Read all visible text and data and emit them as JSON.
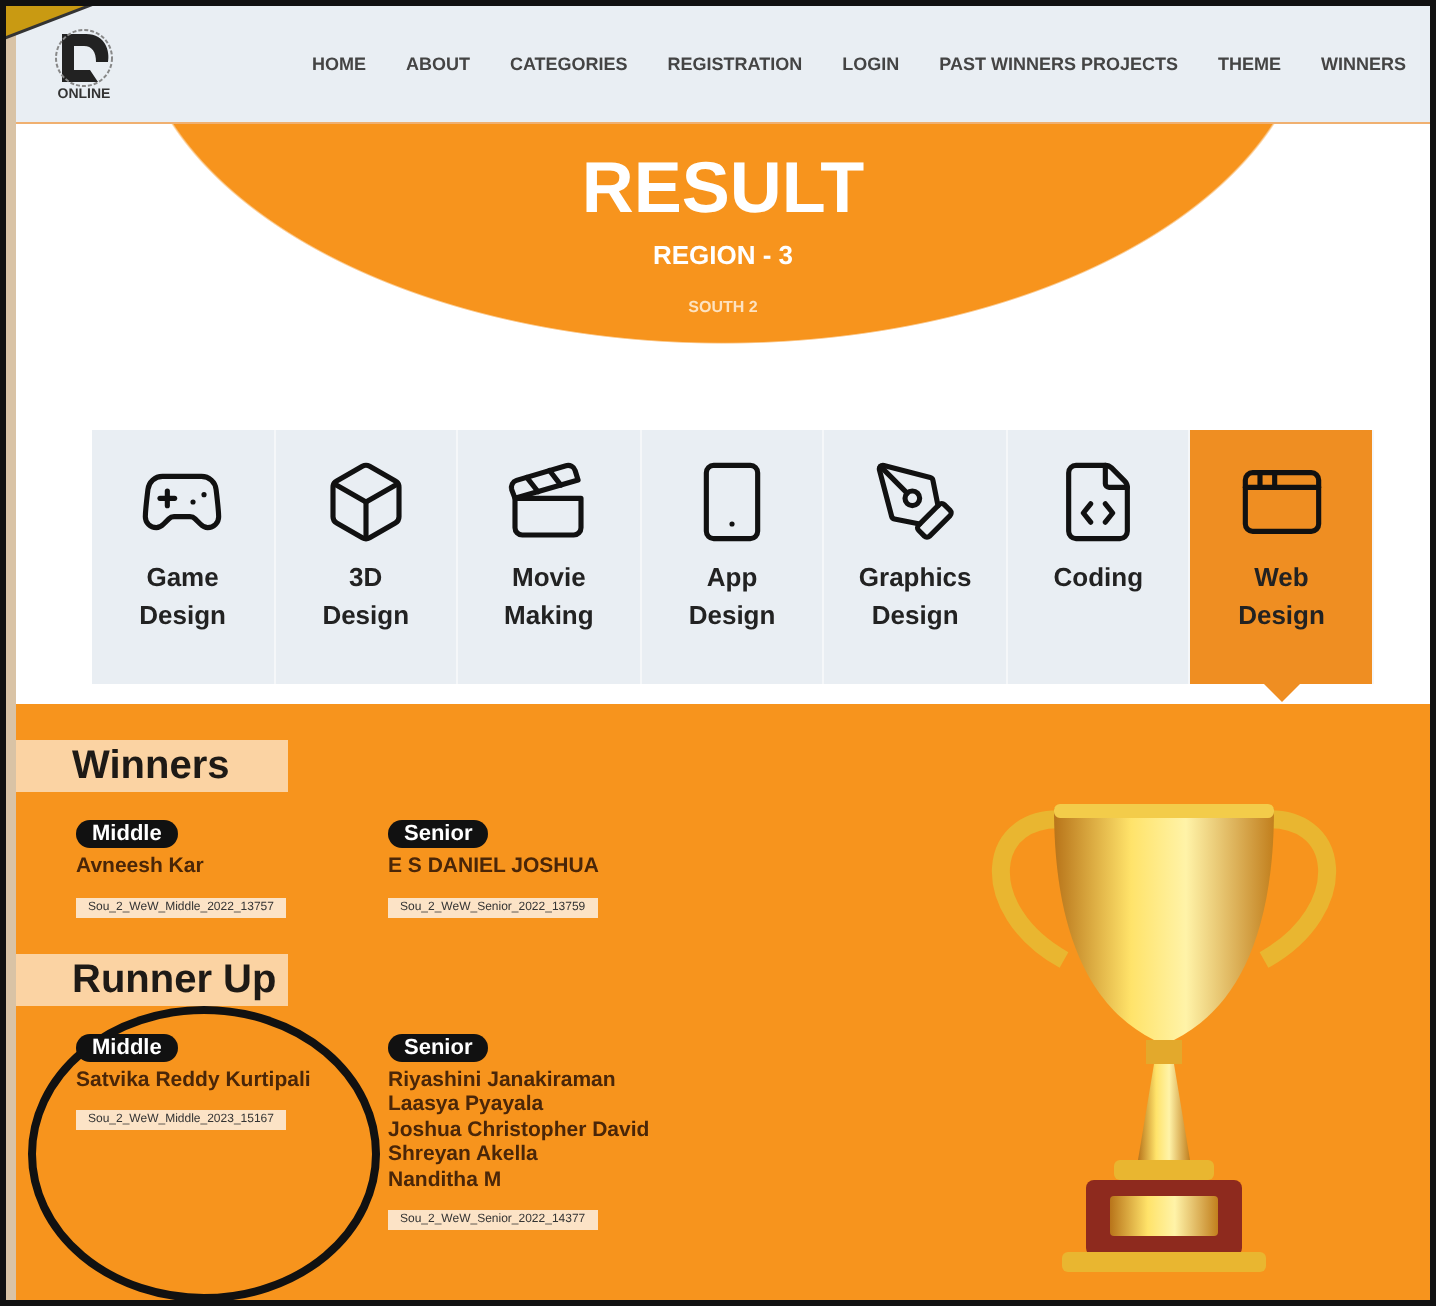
{
  "header": {
    "logo_text": "ONLINE",
    "nav": [
      {
        "label": "HOME"
      },
      {
        "label": "ABOUT"
      },
      {
        "label": "CATEGORIES"
      },
      {
        "label": "REGISTRATION"
      },
      {
        "label": "LOGIN"
      },
      {
        "label": "PAST WINNERS PROJECTS"
      },
      {
        "label": "THEME"
      },
      {
        "label": "WINNERS"
      }
    ]
  },
  "hero": {
    "title": "RESULT",
    "region": "REGION - 3",
    "subregion": "SOUTH 2"
  },
  "categories": [
    {
      "label": "Game Design",
      "selected": false
    },
    {
      "label": "3D Design",
      "selected": false
    },
    {
      "label": "Movie Making",
      "selected": false
    },
    {
      "label": "App Design",
      "selected": false
    },
    {
      "label": "Graphics Design",
      "selected": false
    },
    {
      "label": "Coding",
      "selected": false
    },
    {
      "label": "Web Design",
      "selected": true
    }
  ],
  "results": [
    {
      "title": "Winners",
      "entries": [
        {
          "level": "Middle",
          "names": [
            "Avneesh Kar"
          ],
          "code": "Sou_2_WeW_Middle_2022_13757"
        },
        {
          "level": "Senior",
          "names": [
            "E S DANIEL JOSHUA"
          ],
          "code": "Sou_2_WeW_Senior_2022_13759"
        }
      ]
    },
    {
      "title": "Runner Up",
      "entries": [
        {
          "level": "Middle",
          "names": [
            "Satvika Reddy Kurtipali"
          ],
          "code": "Sou_2_WeW_Middle_2023_15167"
        },
        {
          "level": "Senior",
          "names": [
            "Riyashini Janakiraman",
            "Laasya Pyayala",
            "Joshua Christopher David",
            "Shreyan Akella",
            "Nanditha M"
          ],
          "code": "Sou_2_WeW_Senior_2022_14377"
        }
      ]
    }
  ]
}
